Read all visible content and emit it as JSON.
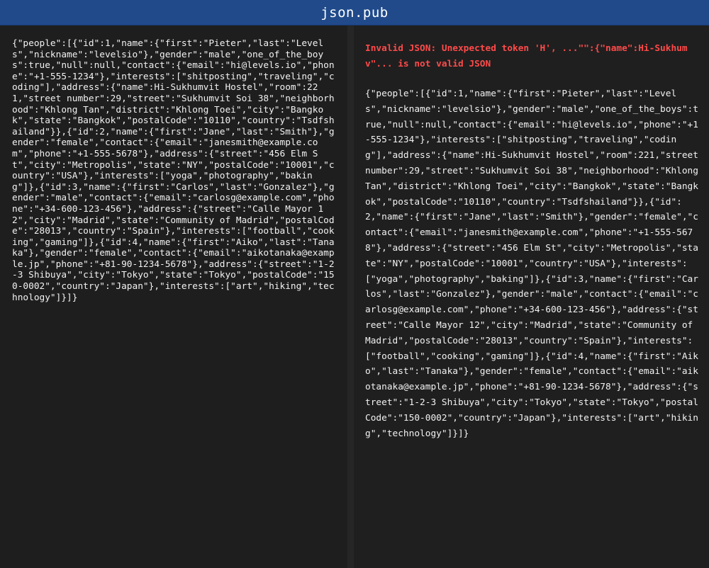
{
  "header": {
    "title": "json.pub"
  },
  "editor": {
    "input_text": "{\"people\":[{\"id\":1,\"name\":{\"first\":\"Pieter\",\"last\":\"Levels\",\"nickname\":\"levelsio\"},\"gender\":\"male\",\"one_of_the_boys\":true,\"null\":null,\"contact\":{\"email\":\"hi@levels.io\",\"phone\":\"+1-555-1234\"},\"interests\":[\"shitposting\",\"traveling\",\"coding\"],\"address\":{\"name\":Hi-Sukhumvit Hostel\",\"room\":221,\"street number\":29,\"street\":\"Sukhumvit Soi 38\",\"neighborhood\":\"Khlong Tan\",\"district\":\"Khlong Toei\",\"city\":\"Bangkok\",\"state\":\"Bangkok\",\"postalCode\":\"10110\",\"country\":\"Tsdfshailand\"}},{\"id\":2,\"name\":{\"first\":\"Jane\",\"last\":\"Smith\"},\"gender\":\"female\",\"contact\":{\"email\":\"janesmith@example.com\",\"phone\":\"+1-555-5678\"},\"address\":{\"street\":\"456 Elm St\",\"city\":\"Metropolis\",\"state\":\"NY\",\"postalCode\":\"10001\",\"country\":\"USA\"},\"interests\":[\"yoga\",\"photography\",\"baking\"]},{\"id\":3,\"name\":{\"first\":\"Carlos\",\"last\":\"Gonzalez\"},\"gender\":\"male\",\"contact\":{\"email\":\"carlosg@example.com\",\"phone\":\"+34-600-123-456\"},\"address\":{\"street\":\"Calle Mayor 12\",\"city\":\"Madrid\",\"state\":\"Community of Madrid\",\"postalCode\":\"28013\",\"country\":\"Spain\"},\"interests\":[\"football\",\"cooking\",\"gaming\"]},{\"id\":4,\"name\":{\"first\":\"Aiko\",\"last\":\"Tanaka\"},\"gender\":\"female\",\"contact\":{\"email\":\"aikotanaka@example.jp\",\"phone\":\"+81-90-1234-5678\"},\"address\":{\"street\":\"1-2-3 Shibuya\",\"city\":\"Tokyo\",\"state\":\"Tokyo\",\"postalCode\":\"150-0002\",\"country\":\"Japan\"},\"interests\":[\"art\",\"hiking\",\"technology\"]}]}"
  },
  "output": {
    "error_message": "Invalid JSON: Unexpected token 'H', ...\"\":{\"name\":Hi-Sukhumv\"... is not valid JSON",
    "echo_text": "{\"people\":[{\"id\":1,\"name\":{\"first\":\"Pieter\",\"last\":\"Levels\",\"nickname\":\"levelsio\"},\"gender\":\"male\",\"one_of_the_boys\":true,\"null\":null,\"contact\":{\"email\":\"hi@levels.io\",\"phone\":\"+1-555-1234\"},\"interests\":[\"shitposting\",\"traveling\",\"coding\"],\"address\":{\"name\":Hi-Sukhumvit Hostel\",\"room\":221,\"street number\":29,\"street\":\"Sukhumvit Soi 38\",\"neighborhood\":\"Khlong Tan\",\"district\":\"Khlong Toei\",\"city\":\"Bangkok\",\"state\":\"Bangkok\",\"postalCode\":\"10110\",\"country\":\"Tsdfshailand\"}},{\"id\":2,\"name\":{\"first\":\"Jane\",\"last\":\"Smith\"},\"gender\":\"female\",\"contact\":{\"email\":\"janesmith@example.com\",\"phone\":\"+1-555-5678\"},\"address\":{\"street\":\"456 Elm St\",\"city\":\"Metropolis\",\"state\":\"NY\",\"postalCode\":\"10001\",\"country\":\"USA\"},\"interests\":[\"yoga\",\"photography\",\"baking\"]},{\"id\":3,\"name\":{\"first\":\"Carlos\",\"last\":\"Gonzalez\"},\"gender\":\"male\",\"contact\":{\"email\":\"carlosg@example.com\",\"phone\":\"+34-600-123-456\"},\"address\":{\"street\":\"Calle Mayor 12\",\"city\":\"Madrid\",\"state\":\"Community of Madrid\",\"postalCode\":\"28013\",\"country\":\"Spain\"},\"interests\":[\"football\",\"cooking\",\"gaming\"]},{\"id\":4,\"name\":{\"first\":\"Aiko\",\"last\":\"Tanaka\"},\"gender\":\"female\",\"contact\":{\"email\":\"aikotanaka@example.jp\",\"phone\":\"+81-90-1234-5678\"},\"address\":{\"street\":\"1-2-3 Shibuya\",\"city\":\"Tokyo\",\"state\":\"Tokyo\",\"postalCode\":\"150-0002\",\"country\":\"Japan\"},\"interests\":[\"art\",\"hiking\",\"technology\"]}]}"
  },
  "colors": {
    "header_bg": "#204a8a",
    "background": "#1c1c1c",
    "text": "#f2f2f2",
    "error": "#ff4a4a"
  }
}
